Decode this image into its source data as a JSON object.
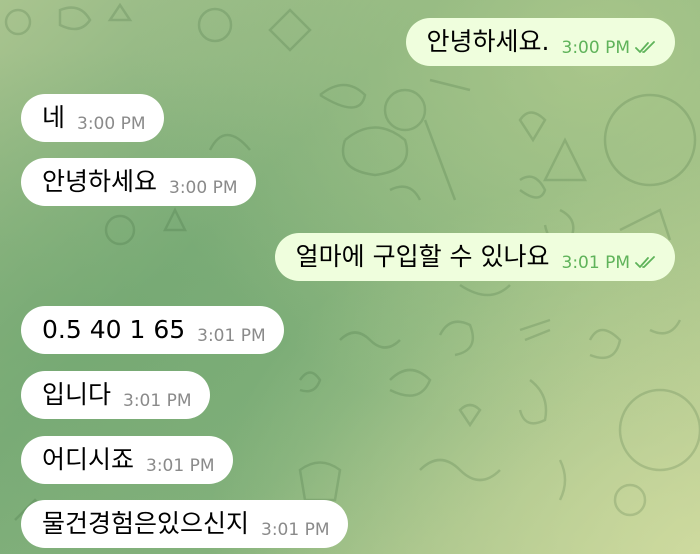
{
  "messages": [
    {
      "direction": "out",
      "text": "안녕하세요.",
      "time": "3:00 PM",
      "read": true
    },
    {
      "direction": "in",
      "text": "네",
      "time": "3:00 PM"
    },
    {
      "direction": "in",
      "text": "안녕하세요",
      "time": "3:00 PM"
    },
    {
      "direction": "out",
      "text": "얼마에 구입할 수 있나요",
      "time": "3:01 PM",
      "read": true
    },
    {
      "direction": "in",
      "text": "0.5 40 1 65",
      "time": "3:01 PM"
    },
    {
      "direction": "in",
      "text": "입니다",
      "time": "3:01 PM"
    },
    {
      "direction": "in",
      "text": "어디시죠",
      "time": "3:01 PM"
    },
    {
      "direction": "in",
      "text": "물건경험은있으신지",
      "time": "3:01 PM"
    }
  ],
  "colors": {
    "incoming_bubble": "#ffffff",
    "outgoing_bubble": "#effedd",
    "outgoing_time": "#5fb35a",
    "incoming_time": "#8a8a8a"
  },
  "icons": {
    "read_receipt": "double-check-icon"
  }
}
